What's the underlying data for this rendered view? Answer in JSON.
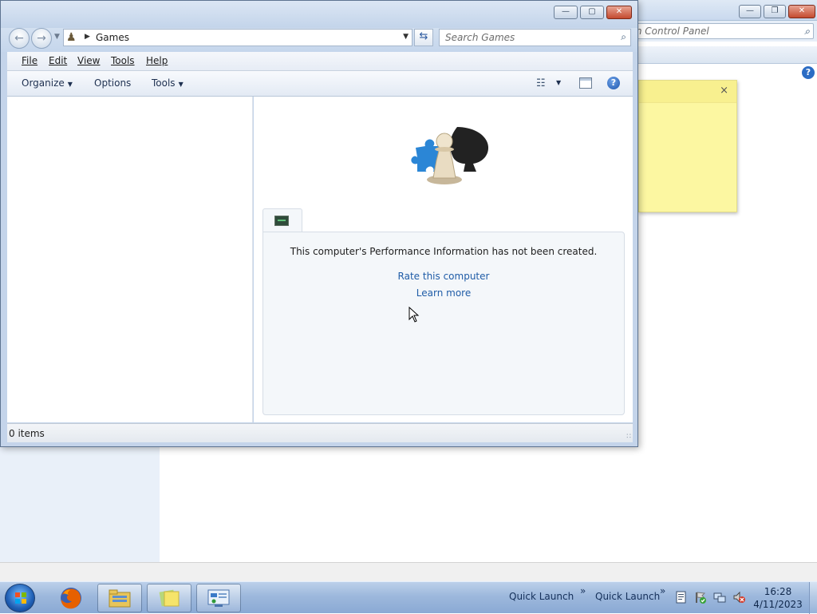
{
  "background_window": {
    "search_placeholder": "Search Control Panel",
    "buttons": {
      "minimize": "—",
      "restore": "❐",
      "close": "✕"
    },
    "help_label": "?"
  },
  "sticky_note": {
    "close": "×"
  },
  "window": {
    "buttons": {
      "minimize": "—",
      "maximize": "▢",
      "close": "✕"
    },
    "address": {
      "path": "Games"
    },
    "search": {
      "placeholder": "Search Games"
    },
    "menu": [
      "File",
      "Edit",
      "View",
      "Tools",
      "Help"
    ],
    "command_bar": {
      "organize": "Organize",
      "options": "Options",
      "tools": "Tools",
      "help": "?"
    },
    "performance": {
      "message": "This computer's Performance Information has not been created.",
      "rate_link": "Rate this computer",
      "learn_link": "Learn more"
    },
    "status": "0 items"
  },
  "taskbar": {
    "quick_launch_1": "Quick Launch",
    "quick_launch_2": "Quick Launch",
    "chevron": "»",
    "time": "16:28",
    "date": "4/11/2023"
  }
}
